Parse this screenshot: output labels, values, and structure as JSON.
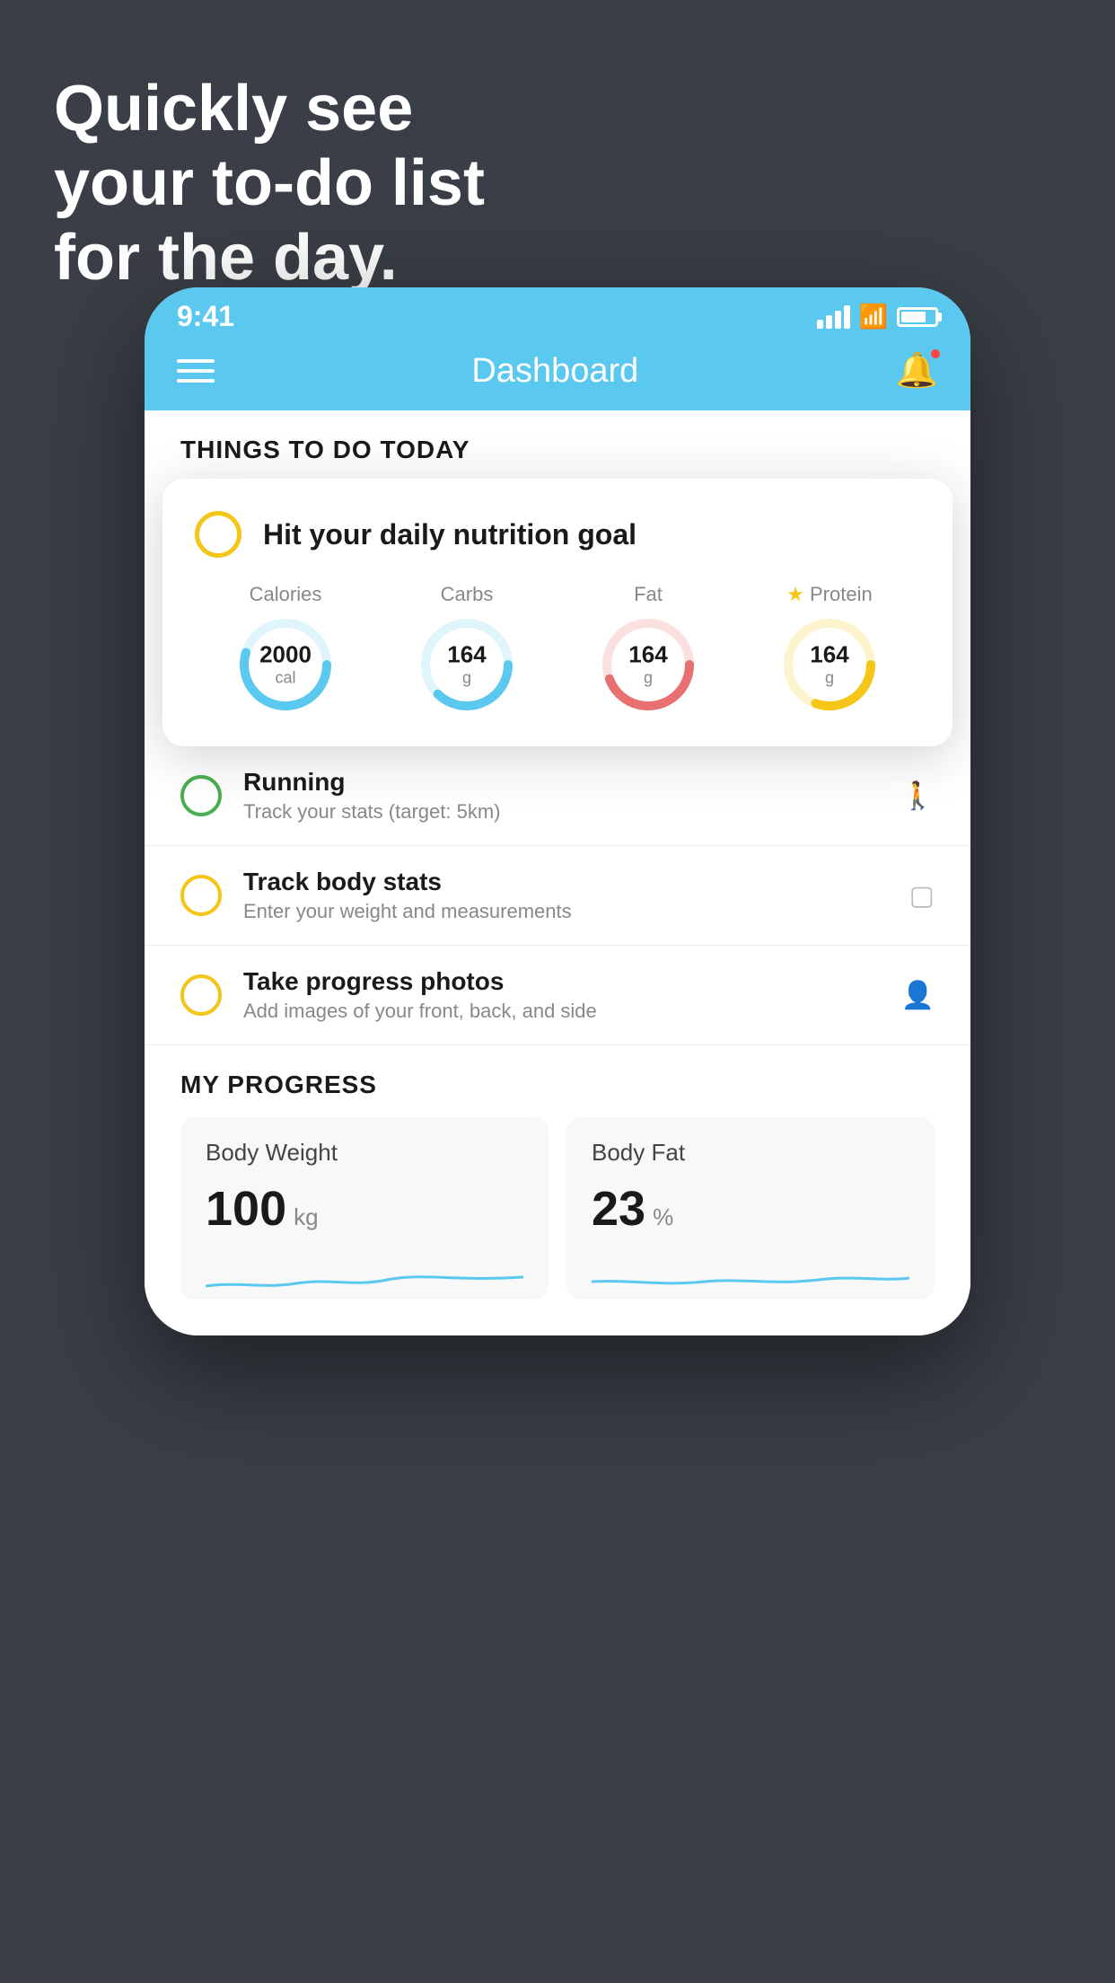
{
  "headline": {
    "line1": "Quickly see",
    "line2": "your to-do list",
    "line3": "for the day."
  },
  "status_bar": {
    "time": "9:41"
  },
  "nav": {
    "title": "Dashboard"
  },
  "section_today": {
    "label": "THINGS TO DO TODAY"
  },
  "nutrition_card": {
    "title": "Hit your daily nutrition goal",
    "items": [
      {
        "label": "Calories",
        "value": "2000",
        "unit": "cal",
        "color": "#5bc8ef",
        "star": false
      },
      {
        "label": "Carbs",
        "value": "164",
        "unit": "g",
        "color": "#5bc8ef",
        "star": false
      },
      {
        "label": "Fat",
        "value": "164",
        "unit": "g",
        "color": "#e87070",
        "star": false
      },
      {
        "label": "Protein",
        "value": "164",
        "unit": "g",
        "color": "#f5c518",
        "star": true
      }
    ]
  },
  "tasks": [
    {
      "title": "Running",
      "subtitle": "Track your stats (target: 5km)",
      "status": "green",
      "icon": "shoe"
    },
    {
      "title": "Track body stats",
      "subtitle": "Enter your weight and measurements",
      "status": "yellow",
      "icon": "scale"
    },
    {
      "title": "Take progress photos",
      "subtitle": "Add images of your front, back, and side",
      "status": "yellow",
      "icon": "portrait"
    }
  ],
  "progress": {
    "header": "MY PROGRESS",
    "cards": [
      {
        "title": "Body Weight",
        "value": "100",
        "unit": "kg"
      },
      {
        "title": "Body Fat",
        "value": "23",
        "unit": "%"
      }
    ]
  }
}
